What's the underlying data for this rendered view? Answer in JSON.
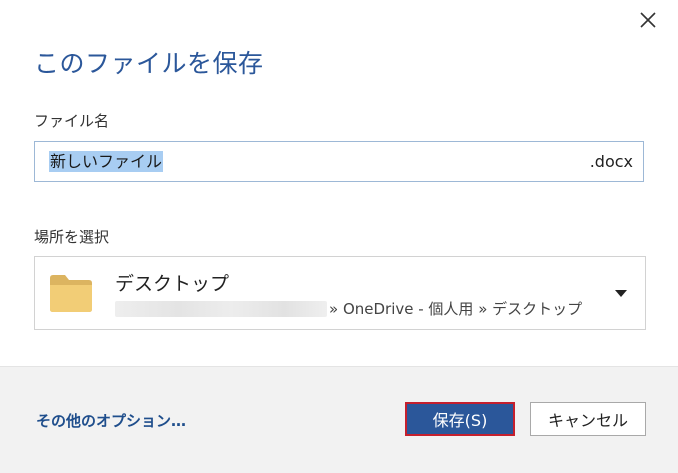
{
  "dialog": {
    "title": "このファイルを保存",
    "close_icon": "close-icon"
  },
  "filename": {
    "label": "ファイル名",
    "value": "新しいファイル",
    "extension": ".docx"
  },
  "location": {
    "label": "場所を選択",
    "folder_icon": "folder-icon",
    "name": "デスクトップ",
    "path_visible": "» OneDrive - 個人用 » デスクトップ",
    "caret_icon": "caret-down-icon"
  },
  "footer": {
    "more_options_label": "その他のオプション…",
    "save_label": "保存(S)",
    "cancel_label": "キャンセル"
  },
  "colors": {
    "accent": "#2b579a",
    "save_focus_border": "#c5202e",
    "selection": "#a8cdf2",
    "footer_bg": "#f2f2f2"
  }
}
